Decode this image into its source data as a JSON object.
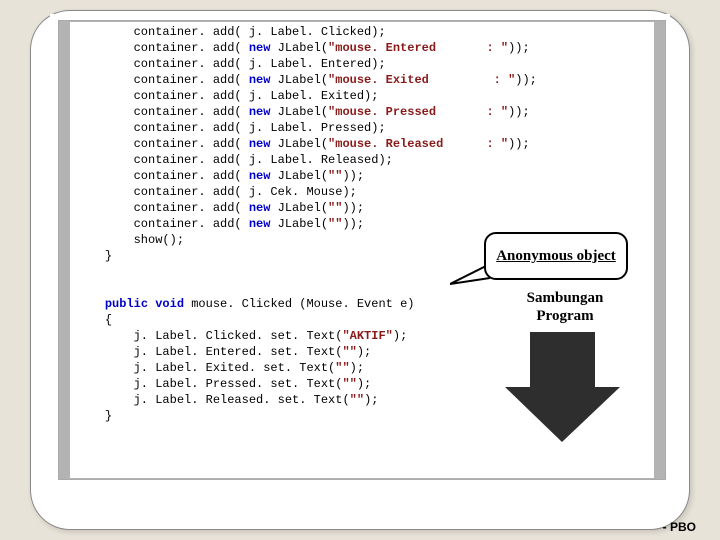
{
  "code": {
    "lines": [
      {
        "indent": 2,
        "segs": [
          [
            "plain",
            "container. add( j. Label. Clicked);"
          ]
        ]
      },
      {
        "indent": 2,
        "segs": [
          [
            "plain",
            "container. add( "
          ],
          [
            "kw",
            "new"
          ],
          [
            "plain",
            " JLabel("
          ],
          [
            "str",
            "\"mouse. Entered       : \""
          ],
          [
            "plain",
            "));"
          ]
        ]
      },
      {
        "indent": 2,
        "segs": [
          [
            "plain",
            "container. add( j. Label. Entered);"
          ]
        ]
      },
      {
        "indent": 2,
        "segs": [
          [
            "plain",
            "container. add( "
          ],
          [
            "kw",
            "new"
          ],
          [
            "plain",
            " JLabel("
          ],
          [
            "str",
            "\"mouse. Exited         : \""
          ],
          [
            "plain",
            "));"
          ]
        ]
      },
      {
        "indent": 2,
        "segs": [
          [
            "plain",
            "container. add( j. Label. Exited);"
          ]
        ]
      },
      {
        "indent": 2,
        "segs": [
          [
            "plain",
            "container. add( "
          ],
          [
            "kw",
            "new"
          ],
          [
            "plain",
            " JLabel("
          ],
          [
            "str",
            "\"mouse. Pressed       : \""
          ],
          [
            "plain",
            "));"
          ]
        ]
      },
      {
        "indent": 2,
        "segs": [
          [
            "plain",
            "container. add( j. Label. Pressed);"
          ]
        ]
      },
      {
        "indent": 2,
        "segs": [
          [
            "plain",
            "container. add( "
          ],
          [
            "kw",
            "new"
          ],
          [
            "plain",
            " JLabel("
          ],
          [
            "str",
            "\"mouse. Released      : \""
          ],
          [
            "plain",
            "));"
          ]
        ]
      },
      {
        "indent": 2,
        "segs": [
          [
            "plain",
            "container. add( j. Label. Released);"
          ]
        ]
      },
      {
        "indent": 2,
        "segs": [
          [
            "plain",
            "container. add( "
          ],
          [
            "kw",
            "new"
          ],
          [
            "plain",
            " JLabel("
          ],
          [
            "str",
            "\"\""
          ],
          [
            "plain",
            "));"
          ]
        ]
      },
      {
        "indent": 2,
        "segs": [
          [
            "plain",
            "container. add( j. Cek. Mouse);"
          ]
        ]
      },
      {
        "indent": 2,
        "segs": [
          [
            "plain",
            "container. add( "
          ],
          [
            "kw",
            "new"
          ],
          [
            "plain",
            " JLabel("
          ],
          [
            "str",
            "\"\""
          ],
          [
            "plain",
            "));"
          ]
        ]
      },
      {
        "indent": 2,
        "segs": [
          [
            "plain",
            "container. add( "
          ],
          [
            "kw",
            "new"
          ],
          [
            "plain",
            " JLabel("
          ],
          [
            "str",
            "\"\""
          ],
          [
            "plain",
            "));"
          ]
        ]
      },
      {
        "indent": 2,
        "segs": [
          [
            "plain",
            "show();"
          ]
        ]
      },
      {
        "indent": 1,
        "segs": [
          [
            "plain",
            "}"
          ]
        ]
      },
      {
        "indent": 1,
        "segs": [
          [
            "plain",
            ""
          ]
        ]
      },
      {
        "indent": 1,
        "segs": [
          [
            "plain",
            ""
          ]
        ]
      },
      {
        "indent": 1,
        "segs": [
          [
            "kw",
            "public void"
          ],
          [
            "plain",
            " mouse. Clicked (Mouse. Event e)"
          ]
        ]
      },
      {
        "indent": 1,
        "segs": [
          [
            "plain",
            "{"
          ]
        ]
      },
      {
        "indent": 2,
        "segs": [
          [
            "plain",
            "j. Label. Clicked. set. Text("
          ],
          [
            "str",
            "\"AKTIF\""
          ],
          [
            "plain",
            ");"
          ]
        ]
      },
      {
        "indent": 2,
        "segs": [
          [
            "plain",
            "j. Label. Entered. set. Text("
          ],
          [
            "str",
            "\"\""
          ],
          [
            "plain",
            ");"
          ]
        ]
      },
      {
        "indent": 2,
        "segs": [
          [
            "plain",
            "j. Label. Exited. set. Text("
          ],
          [
            "str",
            "\"\""
          ],
          [
            "plain",
            ");"
          ]
        ]
      },
      {
        "indent": 2,
        "segs": [
          [
            "plain",
            "j. Label. Pressed. set. Text("
          ],
          [
            "str",
            "\"\""
          ],
          [
            "plain",
            ");"
          ]
        ]
      },
      {
        "indent": 2,
        "segs": [
          [
            "plain",
            "j. Label. Released. set. Text("
          ],
          [
            "str",
            "\"\""
          ],
          [
            "plain",
            ");"
          ]
        ]
      },
      {
        "indent": 1,
        "segs": [
          [
            "plain",
            "}"
          ]
        ]
      }
    ]
  },
  "callout": {
    "label": "Anonymous object"
  },
  "secondary_label": "Sambungan Program",
  "footer": "- PBO",
  "colors": {
    "keyword": "#0000c8",
    "string": "#8a1a1a",
    "arrow": "#2e2e2e"
  }
}
